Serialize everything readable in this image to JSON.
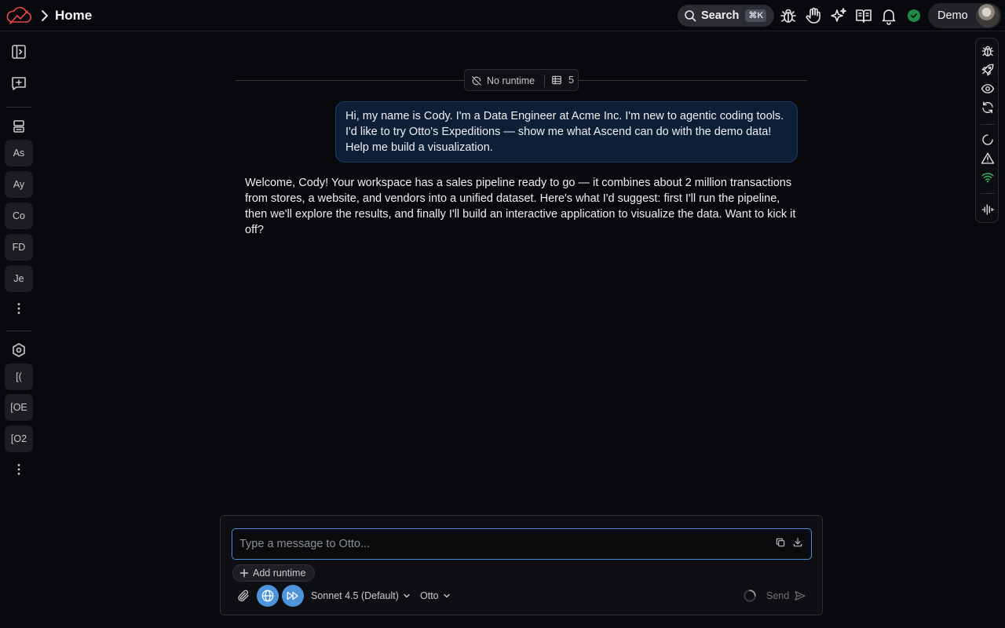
{
  "header": {
    "title": "Home",
    "search_label": "Search",
    "search_shortcut": "⌘K",
    "icons": [
      "bug-icon",
      "hand-icon",
      "sparkles-icon",
      "book-icon",
      "bell-icon",
      "status-check-icon"
    ],
    "user_name": "Demo"
  },
  "sidebar": {
    "top_icons": [
      "panel-toggle-icon",
      "new-chat-icon"
    ],
    "projects": [
      "As",
      "Ay",
      "Co",
      "FD",
      "Je"
    ],
    "workspaces": [
      "[(",
      "[OE",
      "[O2"
    ]
  },
  "right_rail": {
    "icons": [
      "bug-icon",
      "rocket-icon",
      "eye-icon",
      "refresh-icon",
      "loading-icon",
      "warning-icon",
      "wifi-icon",
      "waveform-icon"
    ]
  },
  "chat": {
    "runtime_label": "No runtime",
    "table_count": "5",
    "messages": [
      {
        "role": "user",
        "text": "Hi, my name is Cody. I'm a Data Engineer at Acme Inc. I'm new to agentic coding tools. I'd like to try Otto's Expeditions — show me what Ascend can do with the demo data! Help me build a visualization."
      },
      {
        "role": "assistant",
        "text": "Welcome, Cody! Your workspace has a sales pipeline ready to go — it combines about 2 million transactions from stores, a website, and vendors into a unified dataset. Here's what I'd suggest: first I'll run the pipeline, then we'll explore the results, and finally I'll build an interactive application to visualize the data. Want to kick it off?"
      }
    ]
  },
  "composer": {
    "placeholder": "Type a message to Otto...",
    "value": "",
    "add_runtime_label": "Add runtime",
    "model_label": "Sonnet 4.5 (Default)",
    "agent_label": "Otto",
    "send_label": "Send"
  },
  "colors": {
    "accent": "#4d94db",
    "brand": "#e5484d",
    "status_ok": "#1f8a46",
    "background": "#08090c"
  }
}
